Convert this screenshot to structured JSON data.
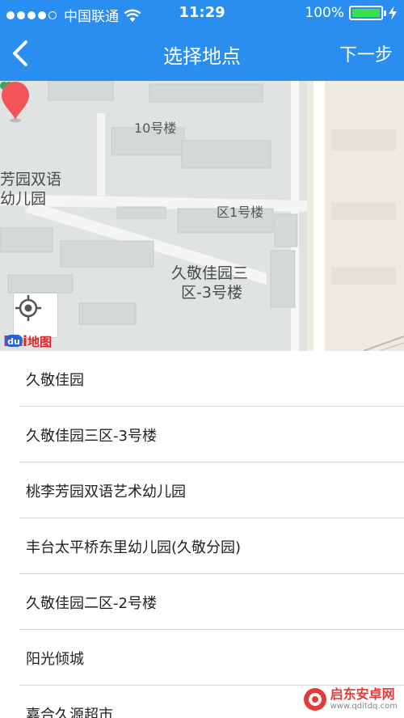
{
  "status_bar": {
    "carrier": "中国联通",
    "time": "11:29",
    "battery_percent": "100%",
    "battery_level": 1.0,
    "signal_filled": 4,
    "signal_total": 5
  },
  "nav": {
    "title": "选择地点",
    "next_label": "下一步"
  },
  "map": {
    "labels": {
      "bldg_10": "10号楼",
      "kindergarten_1": "芳园双语",
      "kindergarten_2": "幼儿园",
      "bldg_1": "区1号楼",
      "jiuyuan_1": "久敬佳园三",
      "jiuyuan_2": "区-3号楼"
    },
    "logo_text": "Bai",
    "logo_word": "地图"
  },
  "places": [
    "久敬佳园",
    "久敬佳园三区-3号楼",
    "桃李芳园双语艺术幼儿园",
    "丰台太平桥东里幼儿园(久敬分园)",
    "久敬佳园二区-2号楼",
    "阳光倾城",
    "嘉合久源超市"
  ],
  "watermark": {
    "title": "启东安卓网",
    "url": "www.qdltdq.com"
  },
  "colors": {
    "nav_bg": "#2a8ef0",
    "pin": "#f05656",
    "battery": "#3ee04a",
    "baidu_red": "#e0262c"
  }
}
